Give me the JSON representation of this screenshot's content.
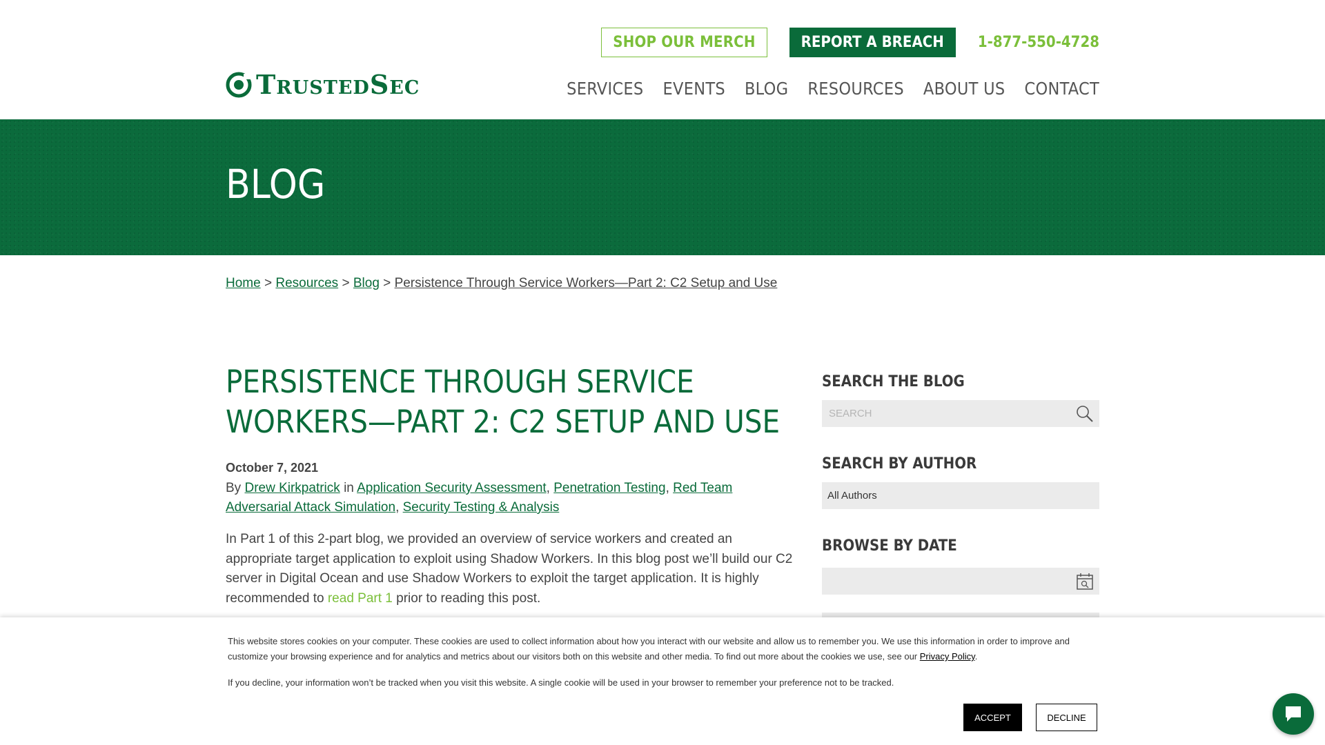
{
  "header": {
    "shop_label": "SHOP OUR MERCH",
    "breach_label": "REPORT A BREACH",
    "phone": "1-877-550-4728",
    "logo_text": "TrustedSec",
    "nav": [
      "SERVICES",
      "EVENTS",
      "BLOG",
      "RESOURCES",
      "ABOUT US",
      "CONTACT"
    ]
  },
  "banner": {
    "title": "BLOG"
  },
  "breadcrumb": {
    "home": "Home",
    "resources": "Resources",
    "blog": "Blog",
    "current": "Persistence Through Service Workers—Part 2: C2 Setup and Use",
    "sep": ">"
  },
  "article": {
    "title": "PERSISTENCE THROUGH SERVICE WORKERS—PART 2: C2 SETUP AND USE",
    "date": "October 7, 2021",
    "by": "By",
    "author": "Drew Kirkpatrick",
    "in": "in",
    "categories": [
      "Application Security Assessment",
      "Penetration Testing",
      "Red Team Adversarial Attack Simulation",
      "Security Testing & Analysis"
    ],
    "intro_text": "In Part 1 of this 2-part blog, we provided an overview of service workers and created an appropriate target application to exploit using Shadow Workers. In this blog post we’ll build our C2 server in Digital Ocean and use Shadow Workers to exploit the target application. It is highly recommended to",
    "intro_link": "read Part 1",
    "intro_end": "prior to reading this post."
  },
  "sidebar": {
    "search_heading": "SEARCH THE BLOG",
    "search_placeholder": "SEARCH",
    "author_heading": "SEARCH BY AUTHOR",
    "author_value": "All Authors",
    "date_heading": "BROWSE BY DATE"
  },
  "cookie": {
    "text1": "This website stores cookies on your computer. These cookies are used to collect information about how you interact with our website and allow us to remember you. We use this information in order to improve and customize your browsing experience and for analytics and metrics about our visitors both on this website and other media. To find out more about the cookies we use, see our",
    "privacy_link": "Privacy Policy",
    "text2": "If you decline, your information won’t be tracked when you visit this website. A single cookie will be used in your browser to remember your preference not to be tracked.",
    "accept": "ACCEPT",
    "decline": "DECLINE"
  },
  "colors": {
    "brand_green": "#0a6b3a",
    "light_green": "#7bbf3a"
  }
}
